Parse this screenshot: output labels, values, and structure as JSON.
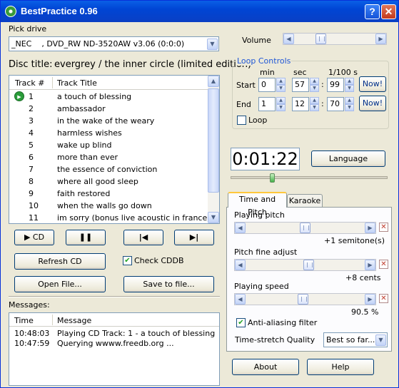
{
  "window": {
    "title": "BestPractice 0.96",
    "help_btn": "?",
    "close_btn": "✕"
  },
  "drive": {
    "label": "Pick drive",
    "value": "_NEC    , DVD_RW ND-3520AW v3.06 (0:0:0)"
  },
  "disc": {
    "label": "Disc title:",
    "value": "evergrey / the inner circle (limited edition)"
  },
  "tracklist": {
    "col_num": "Track #",
    "col_title": "Track Title",
    "playing_index": 0,
    "rows": [
      {
        "num": "1",
        "title": "a touch of blessing"
      },
      {
        "num": "2",
        "title": "ambassador"
      },
      {
        "num": "3",
        "title": "in the wake of the weary"
      },
      {
        "num": "4",
        "title": "harmless wishes"
      },
      {
        "num": "5",
        "title": "wake up blind"
      },
      {
        "num": "6",
        "title": "more than ever"
      },
      {
        "num": "7",
        "title": "the essence of conviction"
      },
      {
        "num": "8",
        "title": "where all good sleep"
      },
      {
        "num": "9",
        "title": "faith restored"
      },
      {
        "num": "10",
        "title": "when the walls go down"
      },
      {
        "num": "11",
        "title": "im sorry (bonus live acoustic in france)"
      }
    ]
  },
  "transport": {
    "cd_label": "CD",
    "pause_icon": "pause-icon",
    "prev_icon": "skip-back-icon",
    "next_icon": "skip-forward-icon"
  },
  "buttons": {
    "refresh": "Refresh CD",
    "check_cddb": "Check CDDB",
    "open_file": "Open File...",
    "save_file": "Save to file...",
    "about": "About",
    "help": "Help",
    "language": "Language",
    "now": "Now!"
  },
  "messages": {
    "label": "Messages:",
    "col_time": "Time",
    "col_message": "Message",
    "rows": [
      {
        "time": "10:48:03",
        "message": "Playing CD Track: 1 - a touch of blessing"
      },
      {
        "time": "10:47:59",
        "message": "Querying wwww.freedb.org ..."
      }
    ]
  },
  "volume": {
    "label": "Volume",
    "level": 0.3
  },
  "loop": {
    "title": "Loop Controls",
    "col_min": "min",
    "col_sec": "sec",
    "col_hundredths": "1/100 s",
    "start_label": "Start",
    "end_label": "End",
    "start": {
      "min": "0",
      "sec": "57",
      "hundredths": "99"
    },
    "end": {
      "min": "1",
      "sec": "12",
      "hundredths": "70"
    },
    "loop_label": "Loop",
    "loop_checked": false,
    "separator": ":"
  },
  "position": {
    "display": "0:01:22",
    "progress": 0.25
  },
  "tabs": {
    "active": "Time and Pitch",
    "other": "Karaoke"
  },
  "pitch": {
    "label": "Playing pitch",
    "value_text": "+1 semitone(s)",
    "level": 0.5
  },
  "fine": {
    "label": "Pitch fine adjust",
    "value_text": "+8 cents",
    "level": 0.53
  },
  "speed": {
    "label": "Playing speed",
    "value_text": "90.5 %",
    "level": 0.48
  },
  "antialias": {
    "label": "Anti-aliasing filter",
    "checked": true
  },
  "quality": {
    "label": "Time-stretch Quality",
    "value": "Best so far..."
  },
  "colors": {
    "titlebar": "#0054e3",
    "play_indicator": "#2a9d3a",
    "active_tab_accent": "#ffc83c"
  }
}
